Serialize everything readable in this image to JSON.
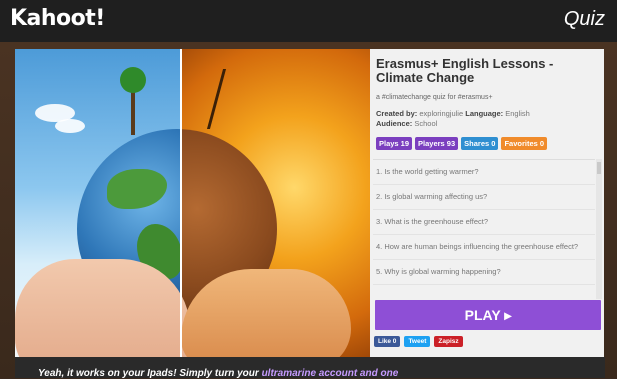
{
  "header": {
    "logo": "Kahoot!",
    "section": "Quiz"
  },
  "quiz": {
    "title": "Erasmus+ English Lessons - Climate Change",
    "description": "a #climatechange quiz for #erasmus+",
    "created_by_label": "Created by:",
    "created_by": "exploringjulie",
    "language_label": "Language:",
    "language": "English",
    "audience_label": "Audience:",
    "audience": "School",
    "stats": [
      {
        "label": "Plays 19",
        "color": "#7b3fbf"
      },
      {
        "label": "Players 93",
        "color": "#7b3fbf"
      },
      {
        "label": "Shares 0",
        "color": "#2f8fd1"
      },
      {
        "label": "Favorites 0",
        "color": "#f08b2b"
      }
    ],
    "questions": [
      "1. Is the world getting warmer?",
      "2. Is global warming affecting us?",
      "3. What is the greenhouse effect?",
      "4. How are human beings influencing the greenhouse effect?",
      "5. Why is global warming happening?"
    ],
    "play_label": "PLAY ▸"
  },
  "social": {
    "like": "Like 0",
    "tweet": "Tweet",
    "pin": "Zapisz"
  },
  "footer": {
    "text_a": "Yeah, it works on your Ipads! Simply turn your ",
    "text_b": "ultramarine account and one"
  },
  "colors": {
    "play_button": "#8e4fd6",
    "like_button": "#3b5998",
    "tweet_button": "#1da1f2",
    "pin_button": "#cb2027"
  }
}
